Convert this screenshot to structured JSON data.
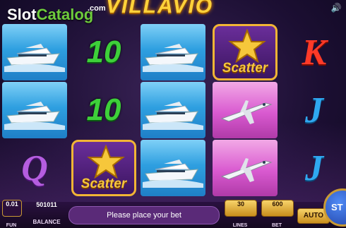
{
  "logo": {
    "part1": "Slot",
    "part2": "Catalog",
    "suffix": ".com"
  },
  "game_title": "VILLAVIO",
  "icons": {
    "sound": "speaker-icon"
  },
  "reels": [
    [
      {
        "type": "yacht"
      },
      {
        "type": "yacht"
      },
      {
        "type": "Q",
        "text": "Q"
      }
    ],
    [
      {
        "type": "ten",
        "text": "10"
      },
      {
        "type": "ten",
        "text": "10"
      },
      {
        "type": "scatter",
        "text": "Scatter"
      }
    ],
    [
      {
        "type": "yacht"
      },
      {
        "type": "yacht"
      },
      {
        "type": "yacht"
      }
    ],
    [
      {
        "type": "scatter",
        "text": "Scatter"
      },
      {
        "type": "plane"
      },
      {
        "type": "plane"
      }
    ],
    [
      {
        "type": "K",
        "text": "K"
      },
      {
        "type": "J",
        "text": "J"
      },
      {
        "type": "J",
        "text": "J"
      }
    ]
  ],
  "bottom": {
    "denom_value": "0.01",
    "denom_label": "FUN",
    "balance_value": "501011",
    "balance_label": "BALANCE",
    "message": "Please place your bet",
    "lines_value": "30",
    "lines_label": "LINES",
    "bet_value": "600",
    "bet_label": "BET",
    "auto_label": "AUTO",
    "spin_label": "ST"
  }
}
